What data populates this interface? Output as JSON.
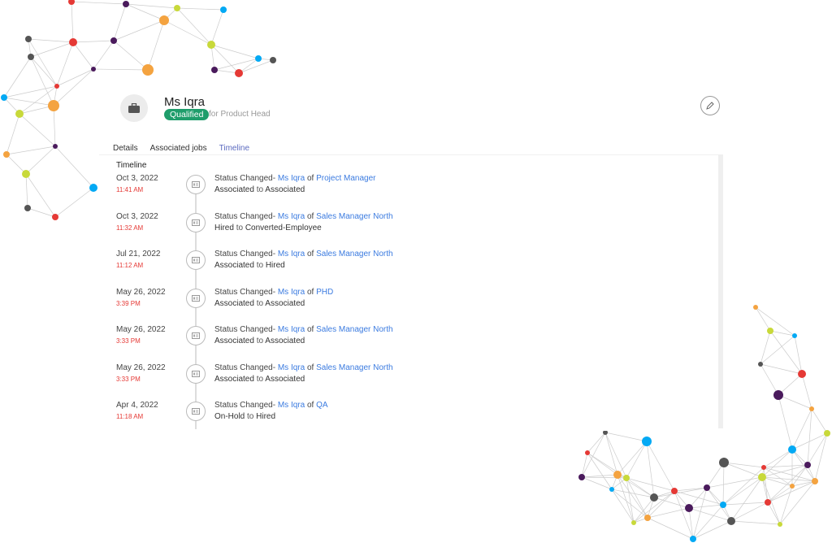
{
  "candidate": {
    "name": "Ms Iqra",
    "status": "Qualified",
    "for_job": "for Product Head"
  },
  "tabs": [
    {
      "label": "Details"
    },
    {
      "label": "Associated jobs"
    },
    {
      "label": "Timeline",
      "active": true
    }
  ],
  "timeline": {
    "title": "Timeline",
    "connector": "of",
    "to_word": "to",
    "items": [
      {
        "date": "Oct 3, 2022",
        "time": "11:41 AM",
        "prefix": "Status Changed-",
        "person": "Ms Iqra",
        "job": "Project Manager",
        "from": "Associated",
        "to": "Associated"
      },
      {
        "date": "Oct 3, 2022",
        "time": "11:32 AM",
        "prefix": "Status Changed-",
        "person": "Ms Iqra",
        "job": "Sales Manager North",
        "from": "Hired",
        "to": "Converted-Employee"
      },
      {
        "date": "Jul 21, 2022",
        "time": "11:12 AM",
        "prefix": "Status Changed-",
        "person": "Ms Iqra",
        "job": "Sales Manager North",
        "from": "Associated",
        "to": "Hired"
      },
      {
        "date": "May 26, 2022",
        "time": "3:39 PM",
        "prefix": "Status Changed-",
        "person": "Ms Iqra",
        "job": "PHD",
        "from": "Associated",
        "to": "Associated"
      },
      {
        "date": "May 26, 2022",
        "time": "3:33 PM",
        "prefix": "Status Changed-",
        "person": "Ms Iqra",
        "job": "Sales Manager North",
        "from": "Associated",
        "to": "Associated"
      },
      {
        "date": "May 26, 2022",
        "time": "3:33 PM",
        "prefix": "Status Changed-",
        "person": "Ms Iqra",
        "job": "Sales Manager North",
        "from": "Associated",
        "to": "Associated"
      },
      {
        "date": "Apr 4, 2022",
        "time": "11:18 AM",
        "prefix": "Status Changed-",
        "person": "Ms Iqra",
        "job": "QA",
        "from": "On-Hold",
        "to": "Hired"
      }
    ]
  },
  "colors": {
    "badge": "#1f9d6b",
    "link": "#3b7be0",
    "time": "#e53935",
    "active_tab": "#5c6bc0"
  },
  "icons": {
    "avatar": "briefcase-icon",
    "edit": "pencil-icon",
    "node": "id-card-icon"
  }
}
